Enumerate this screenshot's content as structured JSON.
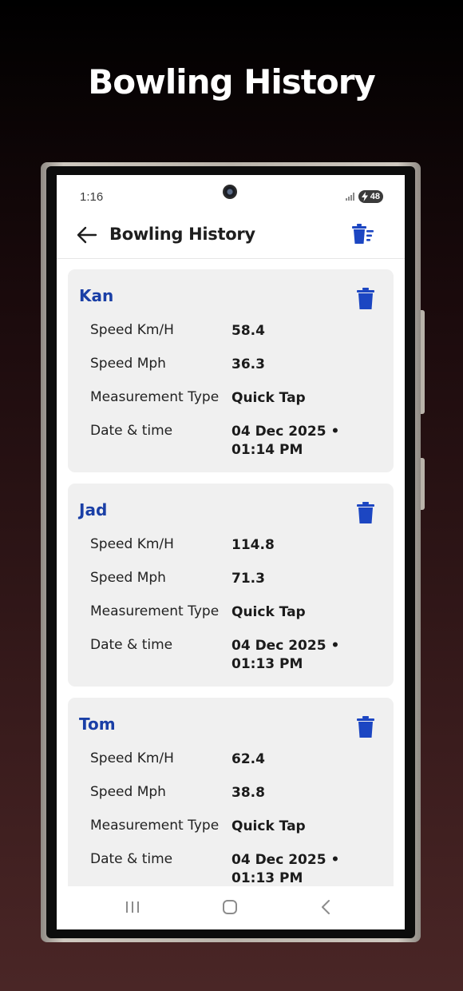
{
  "promo": {
    "title": "Bowling History"
  },
  "status_bar": {
    "time": "1:16",
    "battery": "48"
  },
  "app_bar": {
    "title": "Bowling History"
  },
  "labels": {
    "speed_kmh": "Speed Km/H",
    "speed_mph": "Speed Mph",
    "measurement_type": "Measurement Type",
    "date_time": "Date & time"
  },
  "records": [
    {
      "name": "Kan",
      "speed_kmh": "58.4",
      "speed_mph": "36.3",
      "measurement_type": "Quick Tap",
      "date_time": "04 Dec 2025 • 01:14 PM"
    },
    {
      "name": "Jad",
      "speed_kmh": "114.8",
      "speed_mph": "71.3",
      "measurement_type": "Quick Tap",
      "date_time": "04 Dec 2025 • 01:13 PM"
    },
    {
      "name": "Tom",
      "speed_kmh": "62.4",
      "speed_mph": "38.8",
      "measurement_type": "Quick Tap",
      "date_time": "04 Dec 2025 • 01:13 PM"
    }
  ],
  "icons": {
    "back": "arrow-left-icon",
    "clear_all": "trash-list-icon",
    "delete": "trash-icon",
    "nav_recents": "recents-icon",
    "nav_home": "home-icon",
    "nav_back": "chevron-left-icon"
  },
  "colors": {
    "accent": "#1a3fa6",
    "icon_blue": "#1c46c2",
    "card_bg": "#f0f0f0"
  }
}
